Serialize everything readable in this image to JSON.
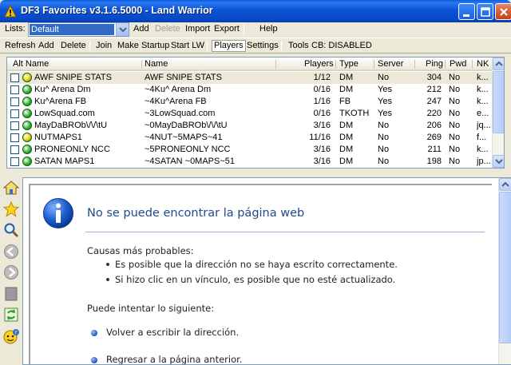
{
  "window": {
    "title": "DF3 Favorites v3.1.6.5000 - Land Warrior"
  },
  "lists_row": {
    "label": "Lists:",
    "selected_list": "Default",
    "items": [
      {
        "label": "Add",
        "enabled": true
      },
      {
        "label": "Delete",
        "enabled": false
      },
      {
        "label": "Import",
        "enabled": true
      },
      {
        "label": "Export",
        "enabled": true
      },
      {
        "label": "Help",
        "enabled": true
      }
    ]
  },
  "toolbar": {
    "items": [
      "Refresh",
      "Add",
      "Delete",
      "Join",
      "Make Startup",
      "Start LW",
      "Players",
      "Settings",
      "Tools"
    ],
    "pressed": "Players",
    "status": "CB: DISABLED"
  },
  "server_list": {
    "columns": [
      "Alt Name",
      "Name",
      "Players",
      "Type",
      "Server",
      "Ping",
      "Pwd",
      "NK"
    ],
    "rows": [
      {
        "alt_name": "AWF SNIPE STATS",
        "name": "AWF SNIPE STATS",
        "players": "1/12",
        "type": "DM",
        "server": "No",
        "ping": "304",
        "pwd": "No",
        "nk": "k...",
        "status_color": "#e8d200",
        "selected": true
      },
      {
        "alt_name": "Ku^ Arena Dm",
        "name": "~4Ku^ Arena Dm",
        "players": "0/16",
        "type": "DM",
        "server": "Yes",
        "ping": "212",
        "pwd": "No",
        "nk": "k...",
        "status_color": "#2fb52f",
        "selected": false
      },
      {
        "alt_name": "Ku^Arena FB",
        "name": "~4Ku^Arena FB",
        "players": "1/16",
        "type": "FB",
        "server": "Yes",
        "ping": "247",
        "pwd": "No",
        "nk": "k...",
        "status_color": "#2fb52f",
        "selected": false
      },
      {
        "alt_name": "LowSquad.com",
        "name": "~3LowSquad.com",
        "players": "0/16",
        "type": "TKOTH",
        "server": "Yes",
        "ping": "220",
        "pwd": "No",
        "nk": "e...",
        "status_color": "#2fb52f",
        "selected": false
      },
      {
        "alt_name": "MayDaBROb\\/\\/\\tU",
        "name": "~0MayDaBROb\\/\\/\\tU",
        "players": "3/16",
        "type": "DM",
        "server": "No",
        "ping": "206",
        "pwd": "No",
        "nk": "jq...",
        "status_color": "#2fb52f",
        "selected": false
      },
      {
        "alt_name": "NUTMAPS1",
        "name": "~4NUT~5MAPS~41",
        "players": "11/16",
        "type": "DM",
        "server": "No",
        "ping": "269",
        "pwd": "No",
        "nk": "f...",
        "status_color": "#e8d200",
        "selected": false
      },
      {
        "alt_name": "PRONEONLY NCC",
        "name": "~5PRONEONLY NCC",
        "players": "3/16",
        "type": "DM",
        "server": "No",
        "ping": "211",
        "pwd": "No",
        "nk": "k...",
        "status_color": "#2fb52f",
        "selected": false
      },
      {
        "alt_name": "SATAN MAPS1",
        "name": "~4SATAN ~0MAPS~51",
        "players": "3/16",
        "type": "DM",
        "server": "No",
        "ping": "198",
        "pwd": "No",
        "nk": "jp...",
        "status_color": "#2fb52f",
        "selected": false
      }
    ]
  },
  "left_tools": [
    "home-icon",
    "favorites-star-icon",
    "search-magnifier-icon",
    "back-arrow-icon",
    "forward-arrow-icon",
    "stop-icon",
    "refresh-icon",
    "help-icon"
  ],
  "browser": {
    "error_title": "No se puede encontrar la página web",
    "causes_heading": "Causas más probables:",
    "causes": [
      "Es posible que la dirección no se haya escrito correctamente.",
      "Si hizo clic en un vínculo, es posible que no esté actualizado."
    ],
    "try_heading": "Puede intentar lo siguiente:",
    "try_items": [
      "Volver a escribir la dirección.",
      "Regresar a la página anterior."
    ]
  },
  "colors": {
    "titlebar": "#0b55d6",
    "selection": "#316ac5",
    "error_title": "#1f4a8c"
  }
}
